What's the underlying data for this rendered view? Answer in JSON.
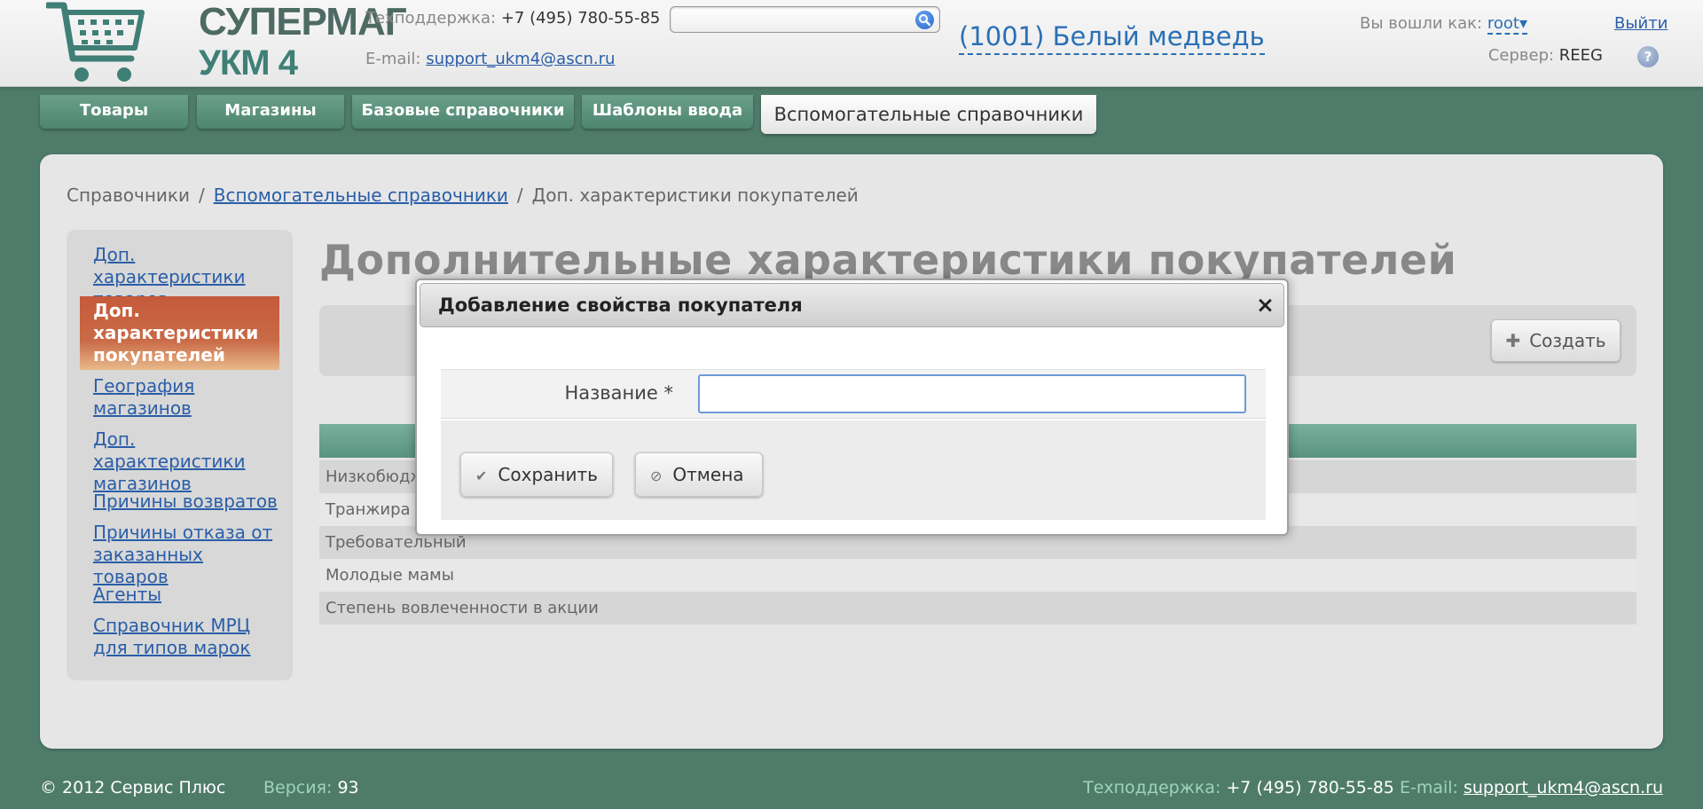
{
  "header": {
    "logo": {
      "line1": "СУПЕРМАГ",
      "line2": "УКМ 4"
    },
    "support_label": "Техподдержка:",
    "support_phone": "+7 (495) 780-55-85",
    "email_label": "E-mail:",
    "email": "support_ukm4@ascn.ru",
    "search": {
      "value": "",
      "placeholder": ""
    },
    "store_name": "(1001) Белый медведь",
    "login_label": "Вы вошли как:",
    "user": "root",
    "user_arrow": "▾",
    "logout": "Выйти",
    "server_label": "Сервер:",
    "server": "REEG",
    "help": "?"
  },
  "tabs": [
    {
      "label": "Товары"
    },
    {
      "label": "Магазины"
    },
    {
      "label": "Базовые справочники"
    },
    {
      "label": "Шаблоны ввода"
    },
    {
      "label": "Вспомогательные справочники",
      "active": true
    }
  ],
  "breadcrumb": {
    "item1": "Справочники",
    "item2": "Вспомогательные справочники",
    "item3": "Доп. характеристики покупателей",
    "sep": "/"
  },
  "sidebar": {
    "items": [
      {
        "label": "Доп. характеристики товаров"
      },
      {
        "label": "Доп. характеристики покупателей",
        "active": true
      },
      {
        "label": "География магазинов"
      },
      {
        "label": "Доп. характеристики магазинов"
      },
      {
        "label": "Причины возвратов"
      },
      {
        "label": "Причины отказа от заказанных товаров"
      },
      {
        "label": "Агенты"
      },
      {
        "label": "Справочник МРЦ для типов марок"
      }
    ]
  },
  "main": {
    "title": "Дополнительные характеристики покупателей",
    "create_label": "Создать",
    "rows": [
      "Низкобюдж",
      "Транжира",
      "Требовательный",
      "Молодые мамы",
      "Степень вовлеченности в акции"
    ]
  },
  "modal": {
    "title": "Добавление свойства покупателя",
    "close": "×",
    "field_label": "Название *",
    "field_value": "",
    "save_label": "Сохранить",
    "cancel_label": "Отмена"
  },
  "footer": {
    "copyright": "© 2012 Сервис Плюс",
    "version_label": "Версия:",
    "version": "93",
    "support_label": "Техподдержка:",
    "support_phone": "+7 (495) 780-55-85",
    "email_label": "E-mail:",
    "email": "support_ukm4@ascn.ru"
  },
  "colors": {
    "background": "#4f7c6a",
    "accent": "#c55a3a",
    "link": "#2a5ea8"
  }
}
